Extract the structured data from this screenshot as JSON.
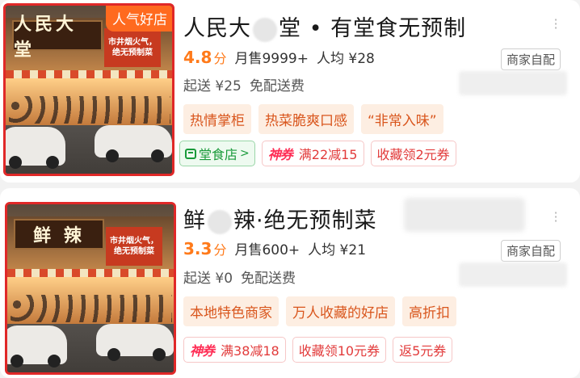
{
  "stores": [
    {
      "image_sign": "人民大 堂",
      "image_banner": [
        "市井烟火气，",
        "绝无预制菜"
      ],
      "ribbon": "人气好店",
      "title_pre": "人民大",
      "title_post": "堂 • 有堂食无预制",
      "score": "4.8",
      "score_unit": "分",
      "monthly_sales": "月售9999+",
      "avg_price": "人均 ¥28",
      "self_delivery": "商家自配",
      "min_order": "起送 ¥25",
      "delivery_fee": "免配送费",
      "features": [
        "热情掌柜",
        "热菜脆爽口感",
        "“非常入味”"
      ],
      "dine_in": "堂食店",
      "promos": [
        {
          "brand": "神券",
          "text": "满22减15"
        },
        {
          "brand": "",
          "text": "收藏领2元券"
        }
      ]
    },
    {
      "image_sign": "鲜 辣",
      "image_banner": [
        "市井烟火气，",
        "绝无预制菜"
      ],
      "title_pre": "鲜",
      "title_post": "辣·绝无预制菜",
      "score": "3.3",
      "score_unit": "分",
      "monthly_sales": "月售600+",
      "avg_price": "人均 ¥21",
      "self_delivery": "商家自配",
      "min_order": "起送 ¥0",
      "delivery_fee": "免配送费",
      "features": [
        "本地特色商家",
        "万人收藏的好店",
        "高折扣"
      ],
      "promos": [
        {
          "brand": "神券",
          "text": "满38减18"
        },
        {
          "brand": "",
          "text": "收藏领10元券"
        },
        {
          "brand": "",
          "text": "返5元券"
        }
      ]
    }
  ],
  "icons": {
    "more": "more-vertical-icon",
    "dine_in": "storefront-icon",
    "chevron": "chevron-right-icon"
  },
  "colors": {
    "accent_orange": "#ff7a1a",
    "highlight_border": "#e02828",
    "promo_red": "#e23b3b",
    "dine_green": "#199a3a"
  }
}
